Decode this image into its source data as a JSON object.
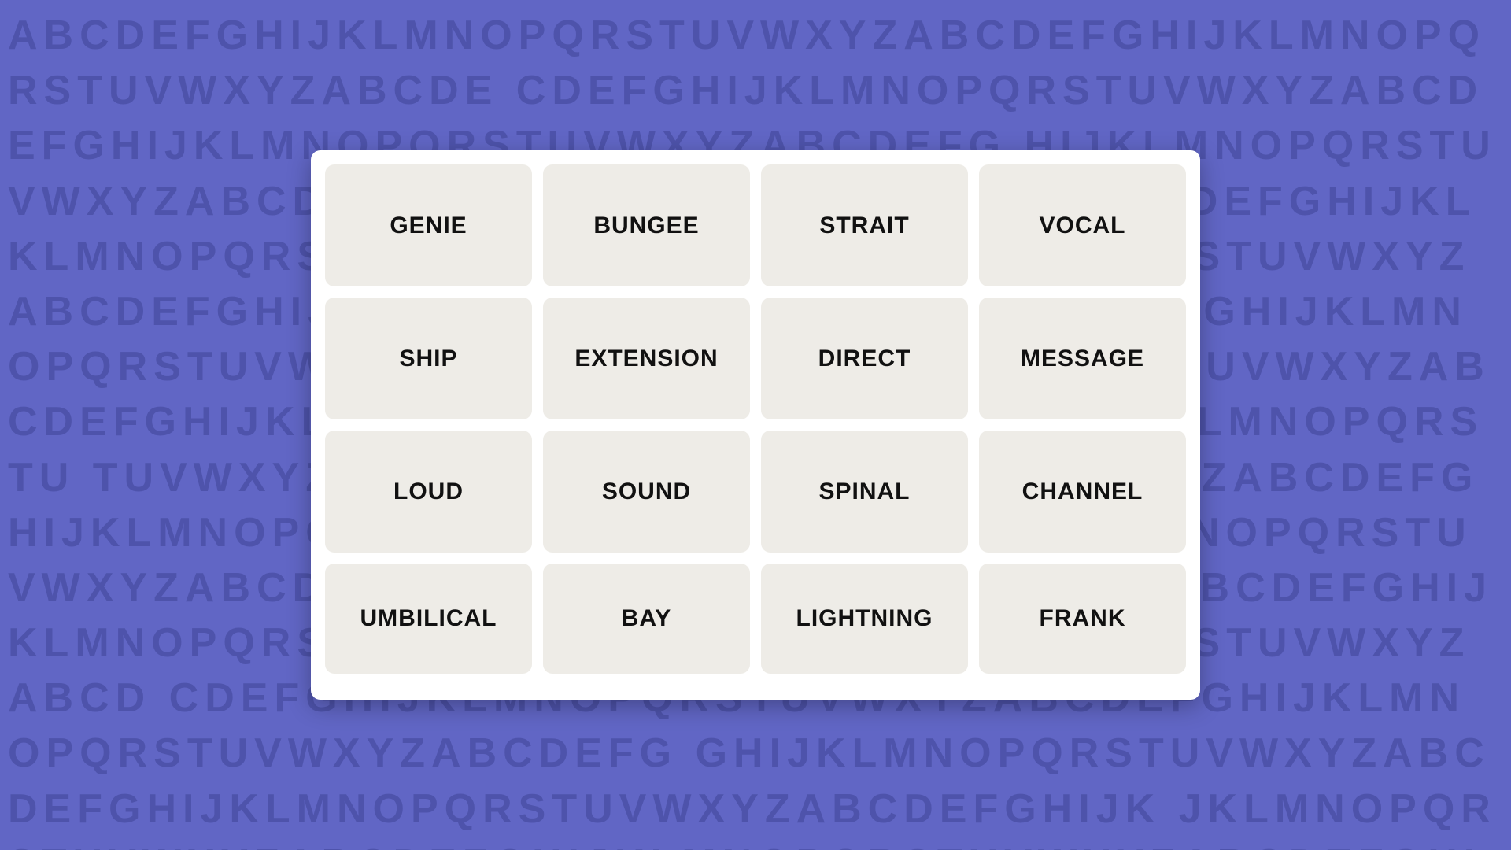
{
  "background": {
    "color": "#6166c5",
    "letters_text": "ABCDEFGHIJKLMNOPQRSTUVWXYZABCDEFGHIJKLMNOPQRSTUVWXYZABCDEFGHIJKLMNOPQRSTUVWXYZABCDEFGHIJKLMNOPQRSTUVWXYZABCDEFGHIJKLMNOPQRSTUVWXYZABCDEFGHIJKLMNOPQRSTUVWXYZABCDEFGHIJKLMNOPQRSTUVWXYZABCDEFGHIJKLMNOPQRSTUVWXYZABCDEFGHIJKLMNOPQRSTUVWXYZ"
  },
  "grid": {
    "rows": [
      [
        "GENIE",
        "BUNGEE",
        "STRAIT",
        "VOCAL"
      ],
      [
        "SHIP",
        "EXTENSION",
        "DIRECT",
        "MESSAGE"
      ],
      [
        "LOUD",
        "SOUND",
        "SPINAL",
        "CHANNEL"
      ],
      [
        "UMBILICAL",
        "BAY",
        "LIGHTNING",
        "FRANK"
      ]
    ]
  }
}
